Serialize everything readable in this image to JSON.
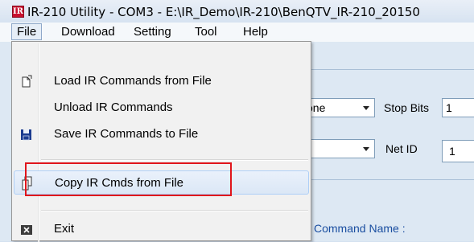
{
  "window": {
    "title": "IR-210 Utility - COM3 - E:\\IR_Demo\\IR-210\\BenQTV_IR-210_20150",
    "app_icon_letter": "IR"
  },
  "menubar": {
    "items": [
      "File",
      "Download",
      "Setting",
      "Tool",
      "Help"
    ],
    "active": "File"
  },
  "file_menu": {
    "items": [
      {
        "label": "Load IR Commands from File",
        "icon": "open-file-icon"
      },
      {
        "label": "Unload IR Commands",
        "icon": ""
      },
      {
        "label": "Save IR Commands to File",
        "icon": "save-disk-icon"
      },
      {
        "label": "Copy IR Cmds from File",
        "icon": "copy-file-icon",
        "highlighted": true
      },
      {
        "label": "Exit",
        "icon": "exit-icon"
      }
    ]
  },
  "background": {
    "parity_value": "one",
    "stop_bits_label": "Stop Bits",
    "stop_bits_value": "1",
    "net_id_label": "Net ID",
    "net_id_value": "1",
    "command_name_label": "Command Name :"
  }
}
